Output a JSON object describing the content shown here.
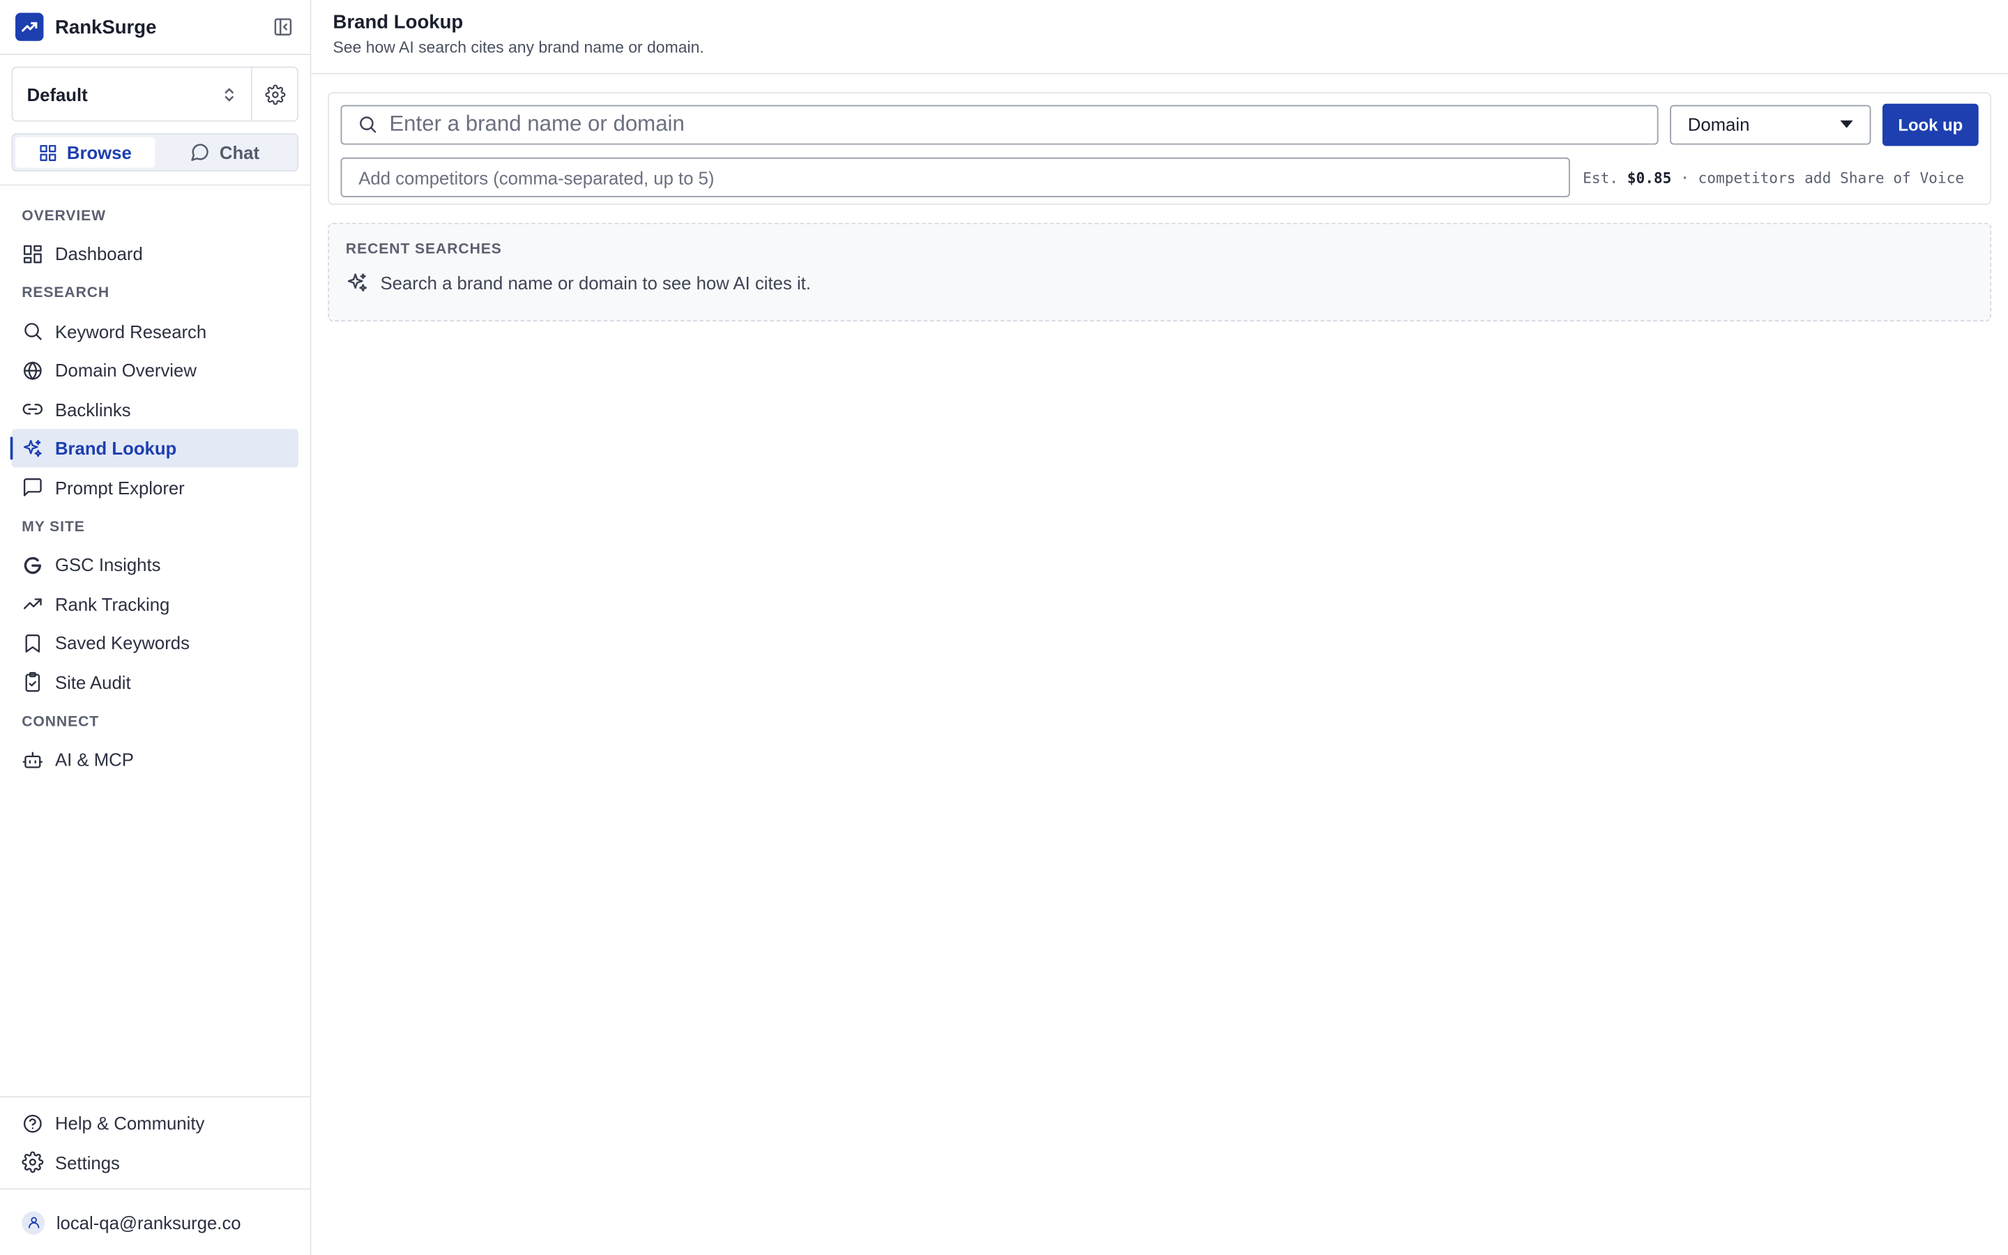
{
  "app": {
    "name": "RankSurge",
    "accent_color": "#1d3fb0"
  },
  "project": {
    "selected": "Default"
  },
  "mode_toggle": {
    "browse": "Browse",
    "chat": "Chat",
    "active": "browse"
  },
  "nav": {
    "overview_label": "OVERVIEW",
    "dashboard": "Dashboard",
    "research_label": "RESEARCH",
    "keyword_research": "Keyword Research",
    "domain_overview": "Domain Overview",
    "backlinks": "Backlinks",
    "brand_lookup": "Brand Lookup",
    "prompt_explorer": "Prompt Explorer",
    "my_site_label": "MY SITE",
    "gsc_insights": "GSC Insights",
    "rank_tracking": "Rank Tracking",
    "saved_keywords": "Saved Keywords",
    "site_audit": "Site Audit",
    "connect_label": "CONNECT",
    "ai_mcp": "AI & MCP",
    "active": "brand_lookup"
  },
  "footer": {
    "help": "Help & Community",
    "settings": "Settings",
    "user_email": "local-qa@ranksurge.co"
  },
  "header": {
    "title": "Brand Lookup",
    "subtitle": "See how AI search cites any brand name or domain."
  },
  "search": {
    "placeholder": "Enter a brand name or domain",
    "value": "",
    "type_selected": "Domain",
    "lookup_label": "Look up",
    "competitors_placeholder": "Add competitors (comma-separated, up to 5)",
    "competitors_value": "",
    "est_prefix": "Est.",
    "est_price": "$0.85",
    "est_suffix": "· competitors add Share of Voice"
  },
  "recent": {
    "label": "RECENT SEARCHES",
    "empty_message": "Search a brand name or domain to see how AI cites it."
  }
}
